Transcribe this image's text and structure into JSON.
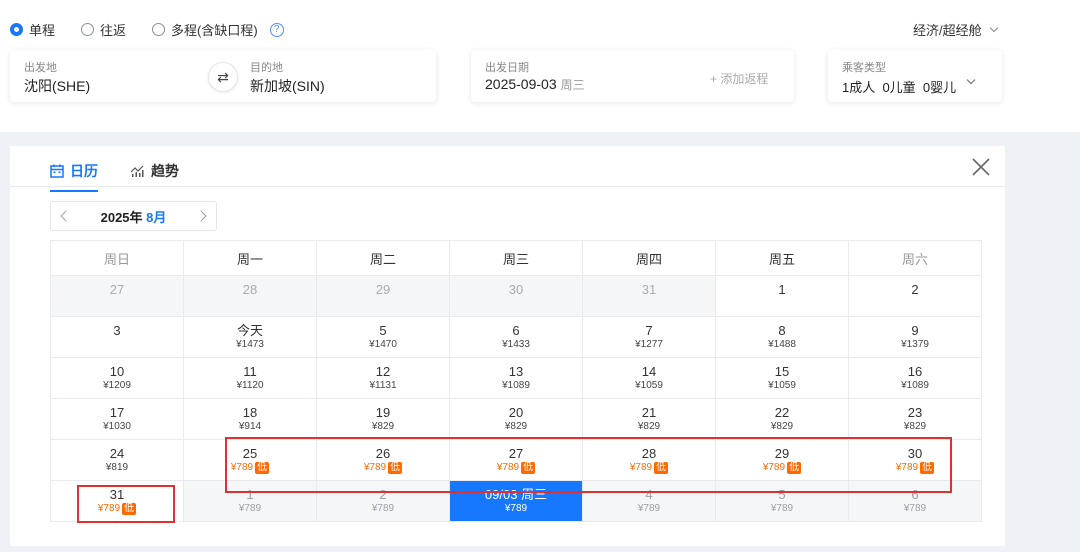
{
  "trip_types": [
    {
      "label": "单程",
      "selected": true
    },
    {
      "label": "往返",
      "selected": false
    },
    {
      "label": "多程(含缺口程)",
      "selected": false
    }
  ],
  "help_icon_text": "?",
  "cabin_label": "经济/超经舱",
  "from": {
    "label": "出发地",
    "value": "沈阳(SHE)"
  },
  "swap_icon": "⇄",
  "to": {
    "label": "目的地",
    "value": "新加坡(SIN)"
  },
  "depart": {
    "label": "出发日期",
    "date": "2025-09-03",
    "weekday": "周三"
  },
  "add_return": "+ 添加返程",
  "passengers": {
    "label": "乘客类型",
    "value": "1成人  0儿童  0婴儿"
  },
  "tabs": [
    {
      "label": "日历",
      "icon": "calendar-icon",
      "active": true
    },
    {
      "label": "趋势",
      "icon": "trend-chart-icon",
      "active": false
    }
  ],
  "month_nav": {
    "year": "2025年",
    "month": "8月"
  },
  "weekdays": [
    "周日",
    "周一",
    "周二",
    "周三",
    "周四",
    "周五",
    "周六"
  ],
  "low_badge": "低",
  "weeks": [
    [
      {
        "d": "27",
        "state": "prev"
      },
      {
        "d": "28",
        "state": "prev"
      },
      {
        "d": "29",
        "state": "prev"
      },
      {
        "d": "30",
        "state": "prev"
      },
      {
        "d": "31",
        "state": "prev"
      },
      {
        "d": "1"
      },
      {
        "d": "2"
      }
    ],
    [
      {
        "d": "3"
      },
      {
        "d": "今天",
        "p": "¥1473"
      },
      {
        "d": "5",
        "p": "¥1470"
      },
      {
        "d": "6",
        "p": "¥1433"
      },
      {
        "d": "7",
        "p": "¥1277"
      },
      {
        "d": "8",
        "p": "¥1488"
      },
      {
        "d": "9",
        "p": "¥1379"
      }
    ],
    [
      {
        "d": "10",
        "p": "¥1209"
      },
      {
        "d": "11",
        "p": "¥1120"
      },
      {
        "d": "12",
        "p": "¥1131"
      },
      {
        "d": "13",
        "p": "¥1089"
      },
      {
        "d": "14",
        "p": "¥1059"
      },
      {
        "d": "15",
        "p": "¥1059"
      },
      {
        "d": "16",
        "p": "¥1089"
      }
    ],
    [
      {
        "d": "17",
        "p": "¥1030"
      },
      {
        "d": "18",
        "p": "¥914"
      },
      {
        "d": "19",
        "p": "¥829"
      },
      {
        "d": "20",
        "p": "¥829"
      },
      {
        "d": "21",
        "p": "¥829"
      },
      {
        "d": "22",
        "p": "¥829"
      },
      {
        "d": "23",
        "p": "¥829"
      }
    ],
    [
      {
        "d": "24",
        "p": "¥819"
      },
      {
        "d": "25",
        "p": "¥789",
        "low": true
      },
      {
        "d": "26",
        "p": "¥789",
        "low": true
      },
      {
        "d": "27",
        "p": "¥789",
        "low": true
      },
      {
        "d": "28",
        "p": "¥789",
        "low": true
      },
      {
        "d": "29",
        "p": "¥789",
        "low": true
      },
      {
        "d": "30",
        "p": "¥789",
        "low": true
      }
    ],
    [
      {
        "d": "31",
        "p": "¥789",
        "low": true
      },
      {
        "d": "1",
        "p": "¥789",
        "state": "next"
      },
      {
        "d": "2",
        "p": "¥789",
        "state": "next"
      },
      {
        "d": "09/03 周三",
        "p": "¥789",
        "state": "selected"
      },
      {
        "d": "4",
        "p": "¥789",
        "state": "next"
      },
      {
        "d": "5",
        "p": "¥789",
        "state": "next"
      },
      {
        "d": "6",
        "p": "¥789",
        "state": "next"
      }
    ]
  ],
  "colors": {
    "accent": "#1677ff",
    "low_price": "#ff6a00",
    "highlight_box": "#e03030"
  }
}
